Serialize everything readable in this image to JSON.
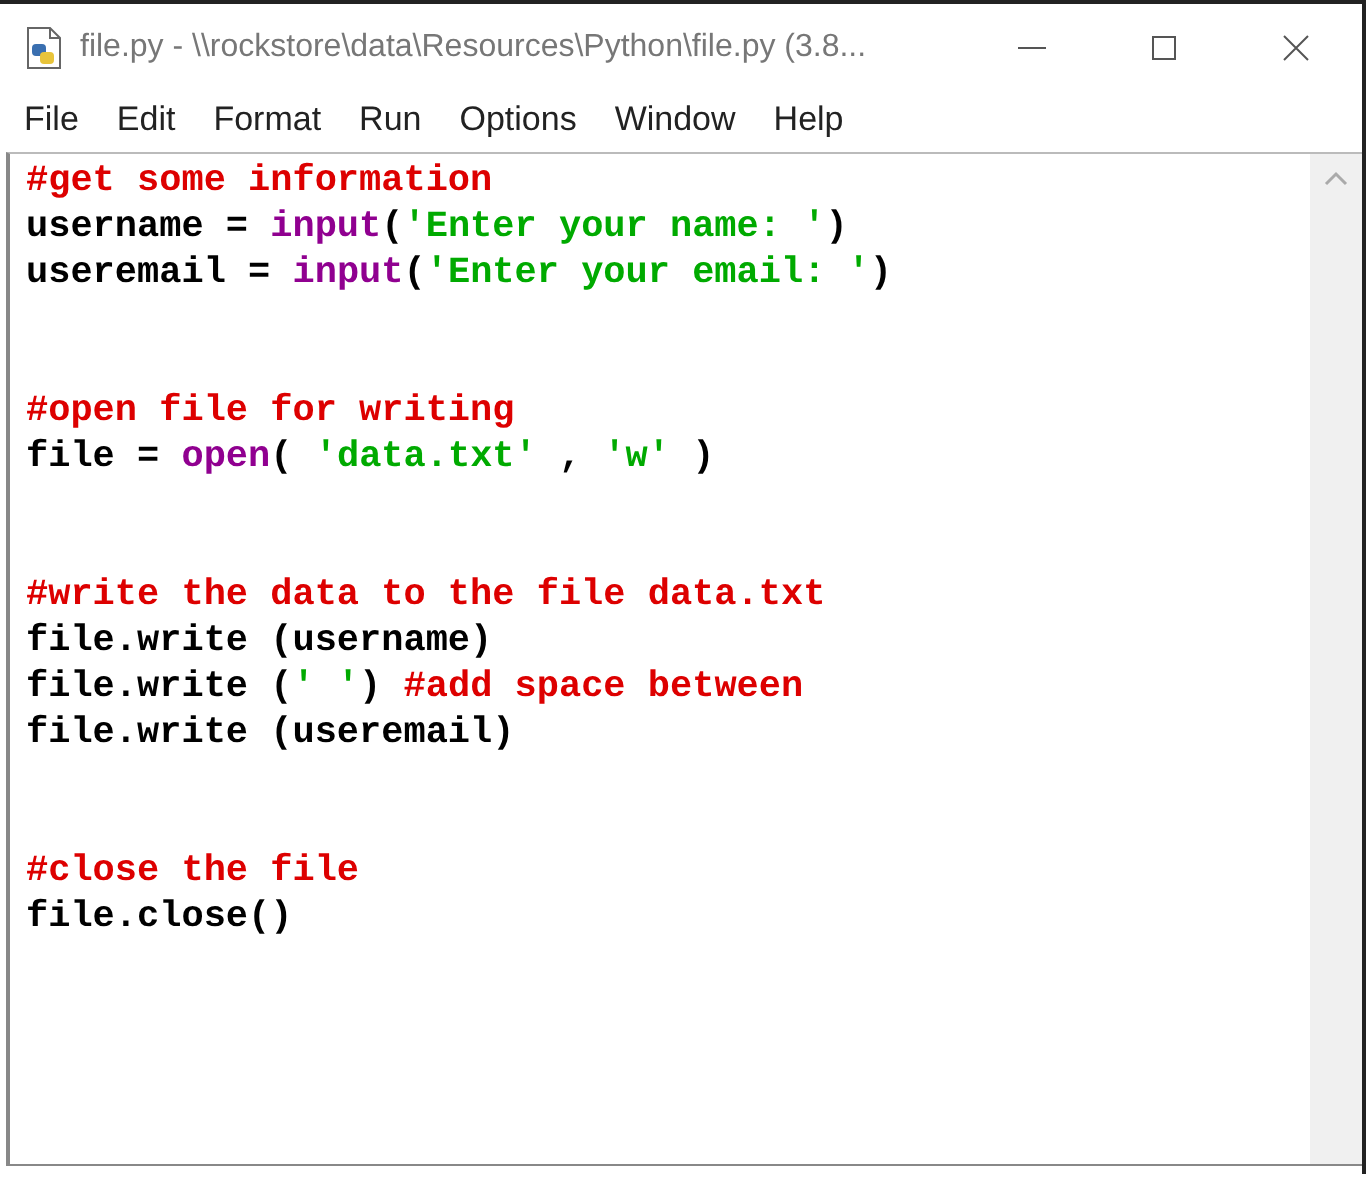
{
  "window": {
    "title": "file.py - \\\\rockstore\\data\\Resources\\Python\\file.py (3.8..."
  },
  "menu": [
    "File",
    "Edit",
    "Format",
    "Run",
    "Options",
    "Window",
    "Help"
  ],
  "editor": {
    "blocks": [
      {
        "lines": [
          [
            {
              "text": "#get some information",
              "kind": "comment"
            }
          ],
          [
            {
              "text": "username = ",
              "kind": "plain"
            },
            {
              "text": "input",
              "kind": "builtin"
            },
            {
              "text": "(",
              "kind": "plain"
            },
            {
              "text": "'Enter your name: '",
              "kind": "string"
            },
            {
              "text": ")",
              "kind": "plain"
            }
          ],
          [
            {
              "text": "useremail = ",
              "kind": "plain"
            },
            {
              "text": "input",
              "kind": "builtin"
            },
            {
              "text": "(",
              "kind": "plain"
            },
            {
              "text": "'Enter your email: '",
              "kind": "string"
            },
            {
              "text": ")",
              "kind": "plain"
            }
          ]
        ]
      },
      {
        "lines": [
          [
            {
              "text": "#open file for writing",
              "kind": "comment"
            }
          ],
          [
            {
              "text": "file = ",
              "kind": "plain"
            },
            {
              "text": "open",
              "kind": "builtin"
            },
            {
              "text": "( ",
              "kind": "plain"
            },
            {
              "text": "'data.txt'",
              "kind": "string"
            },
            {
              "text": " , ",
              "kind": "plain"
            },
            {
              "text": "'w'",
              "kind": "string"
            },
            {
              "text": " )",
              "kind": "plain"
            }
          ]
        ]
      },
      {
        "lines": [
          [
            {
              "text": "#write the data to the file data.txt",
              "kind": "comment"
            }
          ],
          [
            {
              "text": "file.write (username)",
              "kind": "plain"
            }
          ],
          [
            {
              "text": "file.write (",
              "kind": "plain"
            },
            {
              "text": "' '",
              "kind": "string"
            },
            {
              "text": ") ",
              "kind": "plain"
            },
            {
              "text": "#add space between",
              "kind": "comment"
            }
          ],
          [
            {
              "text": "file.write (useremail)",
              "kind": "plain"
            }
          ]
        ]
      },
      {
        "lines": [
          [
            {
              "text": "#close the file",
              "kind": "comment"
            }
          ],
          [
            {
              "text": "file.close()",
              "kind": "plain"
            }
          ]
        ]
      }
    ]
  }
}
